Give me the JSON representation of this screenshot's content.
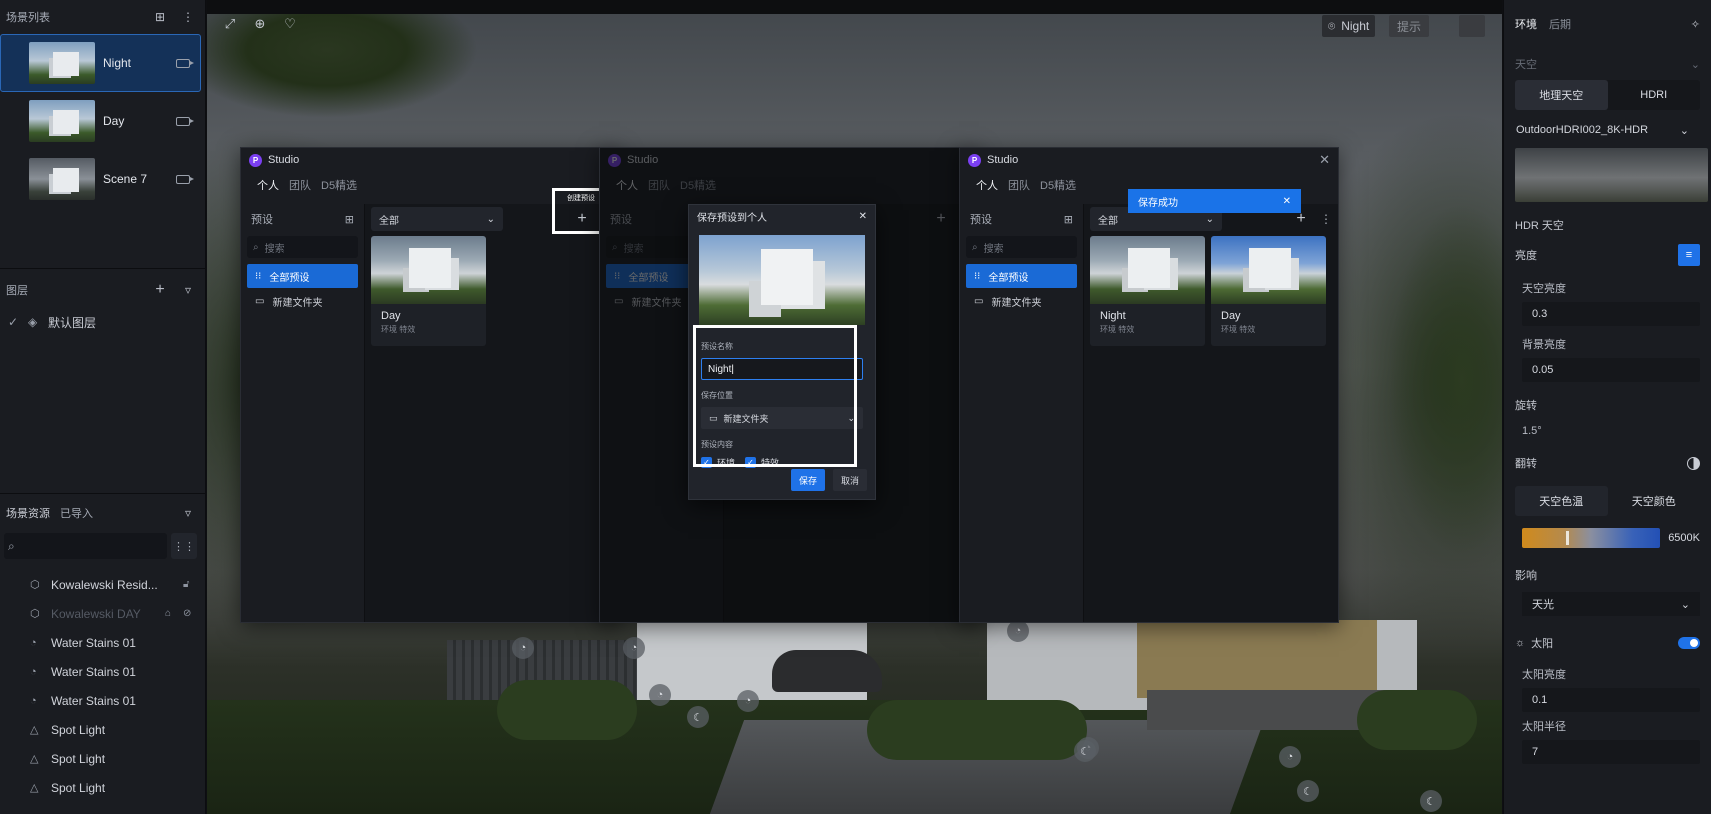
{
  "left": {
    "scene_list_title": "场景列表",
    "scenes": [
      {
        "label": "Night",
        "active": true
      },
      {
        "label": "Day",
        "active": false
      },
      {
        "label": "Scene 7",
        "active": false
      }
    ],
    "layers_title": "图层",
    "default_layer": "默认图层",
    "assets_title": "场景资源",
    "imported_title": "已导入",
    "assets": [
      {
        "label": "Kowalewski Resid...",
        "icon": "cube-icon",
        "dim": false
      },
      {
        "label": "Kowalewski DAY",
        "icon": "cube-icon",
        "dim": true
      },
      {
        "label": "Water Stains 01",
        "icon": "decal-icon",
        "dim": false
      },
      {
        "label": "Water Stains 01",
        "icon": "decal-icon",
        "dim": false
      },
      {
        "label": "Water Stains 01",
        "icon": "decal-icon",
        "dim": false
      },
      {
        "label": "Spot Light",
        "icon": "light-icon",
        "dim": false
      },
      {
        "label": "Spot Light",
        "icon": "light-icon",
        "dim": false
      },
      {
        "label": "Spot Light",
        "icon": "light-icon",
        "dim": false
      }
    ]
  },
  "viewport": {
    "night_chip": "Night",
    "chip2": "提示"
  },
  "studio": {
    "title": "Studio",
    "tabs": [
      "个人",
      "团队",
      "D5精选"
    ],
    "sidebar_title": "预设",
    "search_placeholder": "搜索",
    "all_presets": "全部预设",
    "new_folder": "新建文件夹",
    "filter_value": "全部",
    "card_tags": "环境 特效",
    "create_preset_label": "创建预设",
    "win1_cards": [
      {
        "name": "Day",
        "variant": "night"
      }
    ],
    "win3_cards": [
      {
        "name": "Night",
        "variant": "night"
      },
      {
        "name": "Day",
        "variant": "day"
      }
    ]
  },
  "dialog": {
    "title": "保存预设到个人",
    "name_label": "预设名称",
    "name_value": "Night",
    "location_label": "保存位置",
    "location_value": "新建文件夹",
    "content_label": "预设内容",
    "check_env": "环境",
    "check_fx": "特效",
    "save": "保存",
    "cancel": "取消"
  },
  "toast": {
    "text": "保存成功"
  },
  "right": {
    "tab_env": "环境",
    "tab_post": "后期",
    "sky_section": "天空",
    "seg_geo": "地理天空",
    "seg_hdri": "HDRI",
    "hdri_name": "OutdoorHDRI002_8K-HDR",
    "hdr_sky": "HDR 天空",
    "brightness": "亮度",
    "sky_brightness": "天空亮度",
    "sky_brightness_val": "0.3",
    "bg_brightness": "背景亮度",
    "bg_brightness_val": "0.05",
    "rotation": "旋转",
    "rotation_val": "1.5°",
    "flip": "翻转",
    "sky_temp": "天空色温",
    "sky_color": "天空颜色",
    "temp_value": "6500K",
    "temp_level": 0.32,
    "influence": "影响",
    "influence_value": "天光",
    "sun": "太阳",
    "sun_brightness": "太阳亮度",
    "sun_brightness_val": "0.1",
    "sun_radius": "太阳半径",
    "sun_radius_val": "7"
  }
}
